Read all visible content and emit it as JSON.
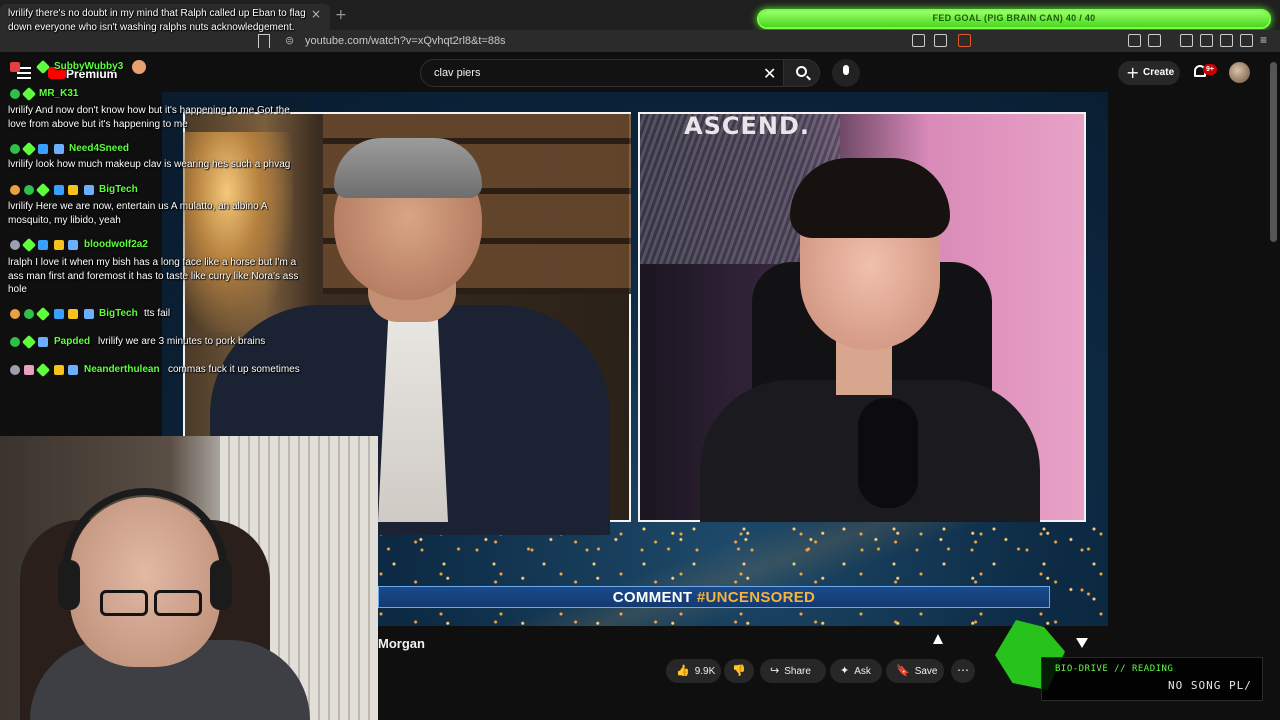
{
  "browser": {
    "url": "youtube.com/watch?v=xQvhqt2rl8&t=88s",
    "tab_close": "×",
    "new_tab": "+"
  },
  "overlay_goal": {
    "text": "FED GOAL (PIG BRAIN CAN) 40 / 40",
    "progress": 1.0
  },
  "youtube": {
    "logo_text": "Premium",
    "search": {
      "value": "clav piers",
      "clear": "✕"
    },
    "create_label": "Create",
    "create_icon": "+",
    "notification_count": "9+"
  },
  "video": {
    "left_backdrop_text": "",
    "right_backdrop_text": "ASCEND.",
    "lower_third": {
      "prefix": "COMMENT",
      "hashtag": "#UNCENSORED"
    }
  },
  "below_video": {
    "title_fragment": "Morgan",
    "like_count": "9.9K",
    "like_icon": "👍",
    "dislike_icon": "👎",
    "share_label": "Share",
    "share_icon": "↪",
    "ask_label": "Ask",
    "ask_icon": "✦",
    "save_label": "Save",
    "save_icon": "🔖",
    "more_icon": "⋯"
  },
  "chat": {
    "top_message": "lvrilify there's no doubt in my mind that Ralph called up Eban to flag down everyone who isn't washing ralphs nuts acknowledgement.",
    "messages": [
      {
        "user": "SubbyWubby3",
        "text": ""
      },
      {
        "user": "MR_K31",
        "text": "lvrilify And now don't know how but it's happening to me Got the love from above but it's happening to me"
      },
      {
        "user": "Need4Sneed",
        "text": "lvrilify look how much makeup clav is wearing hes such a phvag"
      },
      {
        "user": "BigTech",
        "text": "lvrilify Here we are now, entertain us A mulatto, an albino A mosquito, my libido, yeah"
      },
      {
        "user": "bloodwolf2a2",
        "text": "lralph I love it when my bish has a long face like a horse but I'm a ass man first and foremost it has to taste like curry like Nora's ass hole"
      },
      {
        "user": "BigTech",
        "text": "tts fail"
      },
      {
        "user": "Papded",
        "text": "lvrilify we are 3 minutes to pork brains"
      },
      {
        "user": "Neanderthulean",
        "text": "commas fuck it up sometimes"
      }
    ]
  },
  "now_playing": {
    "header": "BIO-DRIVE // READING",
    "song": "NO SONG PL/"
  },
  "colors": {
    "accent_green": "#5dff3c",
    "youtube_red": "#ff0000",
    "lower_third_blue": "#1a4a8c",
    "hashtag_gold": "#f4b43a"
  }
}
